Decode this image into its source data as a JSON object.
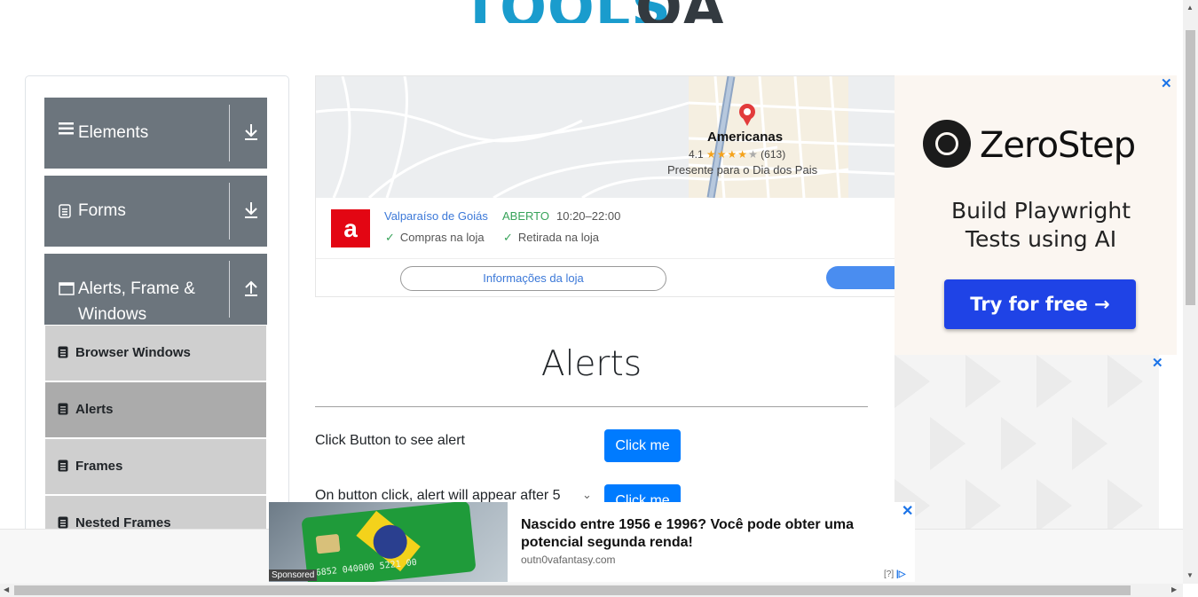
{
  "logo": {
    "tools": "TOOLS",
    "qa": "QA"
  },
  "sidebar": {
    "groups": [
      {
        "label": "Elements"
      },
      {
        "label": "Forms"
      },
      {
        "label": "Alerts, Frame &",
        "label2": "Windows"
      }
    ],
    "items": [
      {
        "label": "Browser Windows"
      },
      {
        "label": "Alerts"
      },
      {
        "label": "Frames"
      },
      {
        "label": "Nested Frames"
      }
    ]
  },
  "map_ad": {
    "place": "Americanas",
    "rating": "4.1",
    "reviews": "(613)",
    "promo": "Presente para o Dia dos Pais",
    "logo_char": "a",
    "city": "Valparaíso de Goiás",
    "status": "ABERTO",
    "hours": "10:20–22:00",
    "feature1": "Compras na loja",
    "feature2": "Retirada na loja",
    "info_button": "Informações da loja"
  },
  "right_ad": {
    "brand": "ZeroStep",
    "tagline1": "Build Playwright",
    "tagline2": "Tests using AI",
    "cta": "Try for free →",
    "close": "✕"
  },
  "main": {
    "title": "Alerts",
    "rows": [
      {
        "label": "Click Button to see alert",
        "button": "Click me"
      },
      {
        "label": "On button click, alert will appear after 5",
        "button": "Click me"
      }
    ]
  },
  "bottom_ad": {
    "headline": "Nascido entre 1956 e 1996? Você pode obter uma potencial segunda renda!",
    "domain": "outn0vafantasy.com",
    "sponsored": "Sponsored",
    "card_number": "6852 040000 5221 00",
    "help": "[?]",
    "close": "✕"
  },
  "colors": {
    "sidebar_header": "#6c757d",
    "sub_item": "#cfcfcf",
    "sub_item_active": "#ababab",
    "primary": "#007bff",
    "logo_blue": "#1a9ccd",
    "cta_blue": "#1f43e6"
  }
}
